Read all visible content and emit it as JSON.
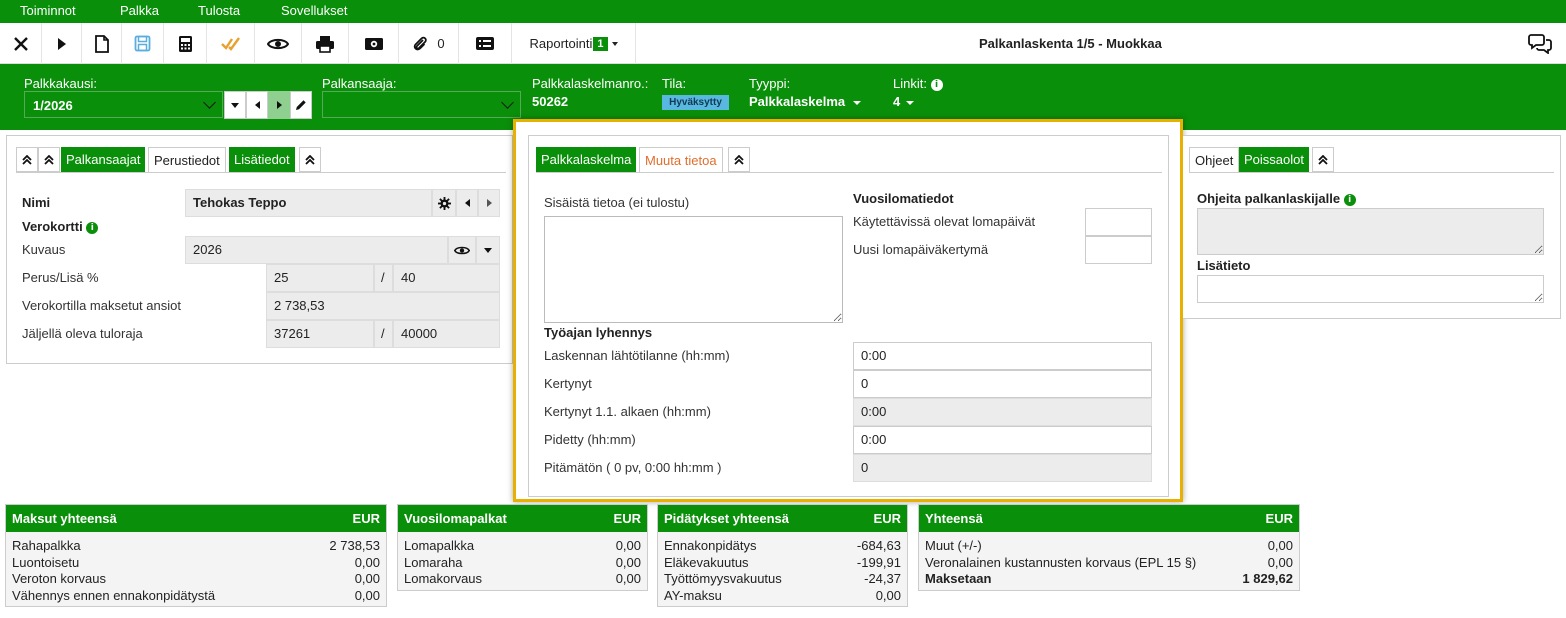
{
  "menu": {
    "items": [
      "Toiminnot",
      "Palkka",
      "Tulosta",
      "Sovellukset"
    ]
  },
  "toolbar": {
    "attachments_count": "0",
    "report_label": "Raportointi",
    "report_badge": "1",
    "title": "Palkanlaskenta 1/5 - Muokkaa"
  },
  "header": {
    "period_label": "Palkkakausi:",
    "period_value": "1/2026",
    "employee_label": "Palkansaaja:",
    "employee_value": "",
    "calc_no_label": "Palkkalaskelmanro.:",
    "calc_no_value": "50262",
    "status_label": "Tila:",
    "status_value": "Hyväksytty",
    "type_label": "Tyyppi:",
    "type_value": "Palkkalaskelma",
    "links_label": "Linkit:",
    "links_value": "4"
  },
  "left_card": {
    "tabs": [
      "Palkansaajat",
      "Perustiedot",
      "Lisätiedot"
    ],
    "name_label": "Nimi",
    "name_value": "Tehokas Teppo",
    "taxcard_label": "Verokortti",
    "desc_label": "Kuvaus",
    "desc_value": "2026",
    "rate_label": "Perus/Lisä %",
    "rate_base": "25",
    "rate_sep": "/",
    "rate_extra": "40",
    "paid_label": "Verokortilla maksetut ansiot",
    "paid_value": "2 738,53",
    "limit_label": "Jäljellä oleva tuloraja",
    "limit_value": "37261",
    "limit_sep": "/",
    "limit_total": "40000"
  },
  "middle_card": {
    "tabs": [
      "Palkkalaskelma",
      "Muuta tietoa"
    ],
    "internal_label": "Sisäistä tietoa (ei tulostu)",
    "internal_value": "",
    "holiday_title": "Vuosilomatiedot",
    "holiday_avail_label": "Käytettävissä olevat lomapäivät",
    "holiday_avail_value": "",
    "holiday_new_label": "Uusi lomapäiväkertymä",
    "holiday_new_value": "",
    "wt_title": "Työajan lyhennys",
    "wt_rows": [
      {
        "label": "Laskennan lähtötilanne (hh:mm)",
        "value": "0:00",
        "readonly": false
      },
      {
        "label": "Kertynyt",
        "value": "0",
        "readonly": false
      },
      {
        "label": "Kertynyt 1.1. alkaen (hh:mm)",
        "value": "0:00",
        "readonly": true
      },
      {
        "label": "Pidetty (hh:mm)",
        "value": "0:00",
        "readonly": false
      },
      {
        "label": "Pitämätön ( 0 pv, 0:00 hh:mm )",
        "value": "0",
        "readonly": true
      }
    ]
  },
  "right_card": {
    "tabs": [
      "Ohjeet",
      "Poissaolot"
    ],
    "instructions_label": "Ohjeita palkanlaskijalle",
    "instructions_value": "",
    "extra_label": "Lisätieto",
    "extra_value": ""
  },
  "summaries": [
    {
      "title": "Maksut yhteensä",
      "currency": "EUR",
      "rows": [
        {
          "label": "Rahapalkka",
          "value": "2 738,53"
        },
        {
          "label": "Luontoisetu",
          "value": "0,00"
        },
        {
          "label": "Veroton korvaus",
          "value": "0,00"
        },
        {
          "label": "Vähennys ennen ennakonpidätystä",
          "value": "0,00"
        }
      ]
    },
    {
      "title": "Vuosilomapalkat",
      "currency": "EUR",
      "rows": [
        {
          "label": "Lomapalkka",
          "value": "0,00"
        },
        {
          "label": "Lomaraha",
          "value": "0,00"
        },
        {
          "label": "Lomakorvaus",
          "value": "0,00"
        }
      ]
    },
    {
      "title": "Pidätykset yhteensä",
      "currency": "EUR",
      "rows": [
        {
          "label": "Ennakonpidätys",
          "value": "-684,63"
        },
        {
          "label": "Eläkevakuutus",
          "value": "-199,91"
        },
        {
          "label": "Työttömyysvakuutus",
          "value": "-24,37"
        },
        {
          "label": "AY-maksu",
          "value": "0,00"
        }
      ]
    },
    {
      "title": "Yhteensä",
      "currency": "EUR",
      "rows": [
        {
          "label": "Muut (+/-)",
          "value": "0,00"
        },
        {
          "label": "Veronalainen kustannusten korvaus (EPL 15 §)",
          "value": "0,00"
        },
        {
          "label": "Maksetaan",
          "value": "1 829,62"
        }
      ]
    }
  ],
  "colors": {
    "brand_green": "#0a8f0a",
    "highlight": "#e8b000",
    "tab_orange": "#e06e2c",
    "status_blue": "#58b8e0"
  }
}
